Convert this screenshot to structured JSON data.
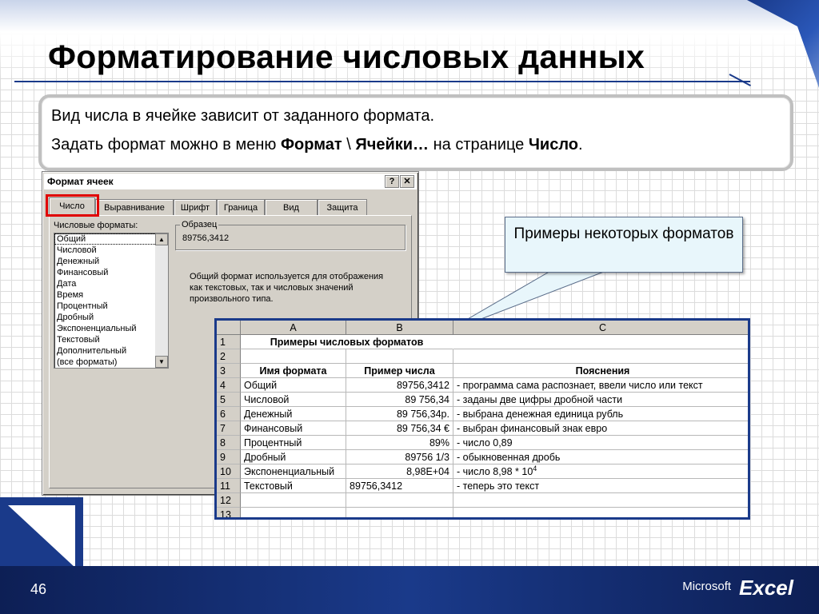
{
  "slide": {
    "title": "Форматирование числовых данных",
    "page_number": "46"
  },
  "info": {
    "line1": "Вид числа в ячейке зависит от заданного формата.",
    "line2_prefix": "Задать формат можно в меню ",
    "line2_menu": "Формат",
    "line2_sep": " \\ ",
    "line2_item": "Ячейки…",
    "line2_mid": " на странице ",
    "line2_page": "Число",
    "line2_end": "."
  },
  "dialog": {
    "title": "Формат ячеек",
    "help_label": "?",
    "close_label": "✕",
    "tabs": [
      "Число",
      "Выравнивание",
      "Шрифт",
      "Граница",
      "Вид",
      "Защита"
    ],
    "formats_label": "Числовые форматы:",
    "formats": [
      "Общий",
      "Числовой",
      "Денежный",
      "Финансовый",
      "Дата",
      "Время",
      "Процентный",
      "Дробный",
      "Экспоненциальный",
      "Текстовый",
      "Дополнительный",
      "(все форматы)"
    ],
    "sample_label": "Образец",
    "sample_value": "89756,3412",
    "description": "Общий формат используется для отображения как текстовых, так и числовых значений произвольного типа."
  },
  "callout": {
    "text": "Примеры некоторых форматов"
  },
  "sheet": {
    "columns": [
      "A",
      "B",
      "C"
    ],
    "rows": [
      {
        "n": "1",
        "a": "Примеры числовых форматов",
        "b": "",
        "c": ""
      },
      {
        "n": "2",
        "a": "",
        "b": "",
        "c": ""
      },
      {
        "n": "3",
        "a": "Имя формата",
        "b": "Пример числа",
        "c": "Пояснения"
      },
      {
        "n": "4",
        "a": "Общий",
        "b": "89756,3412",
        "c": "- программа сама распознает, ввели число или текст"
      },
      {
        "n": "5",
        "a": "Числовой",
        "b": "89 756,34",
        "c": "- заданы две цифры дробной части"
      },
      {
        "n": "6",
        "a": "Денежный",
        "b": "89 756,34р.",
        "c": "- выбрана денежная единица рубль"
      },
      {
        "n": "7",
        "a": "Финансовый",
        "b": "89 756,34 €",
        "c": "- выбран финансовый знак евро"
      },
      {
        "n": "8",
        "a": "Процентный",
        "b": "89%",
        "c": "- число 0,89"
      },
      {
        "n": "9",
        "a": "Дробный",
        "b": "89756 1/3",
        "c": "- обыкновенная дробь"
      },
      {
        "n": "10",
        "a": "Экспоненциальный",
        "b": "8,98E+04",
        "c": "- число 8,98 * 10",
        "c_sup": "4"
      },
      {
        "n": "11",
        "a": "Текстовый",
        "b": "89756,3412",
        "c": "- теперь это текст"
      },
      {
        "n": "12",
        "a": "",
        "b": "",
        "c": ""
      },
      {
        "n": "13",
        "a": "",
        "b": "",
        "c": ""
      }
    ]
  },
  "brand": {
    "company": "Microsoft",
    "product": "Excel"
  },
  "colors": {
    "accent_dark_blue": "#1a3a8a",
    "highlight_red": "#e00000",
    "callout_fill": "#e8f6fb"
  }
}
